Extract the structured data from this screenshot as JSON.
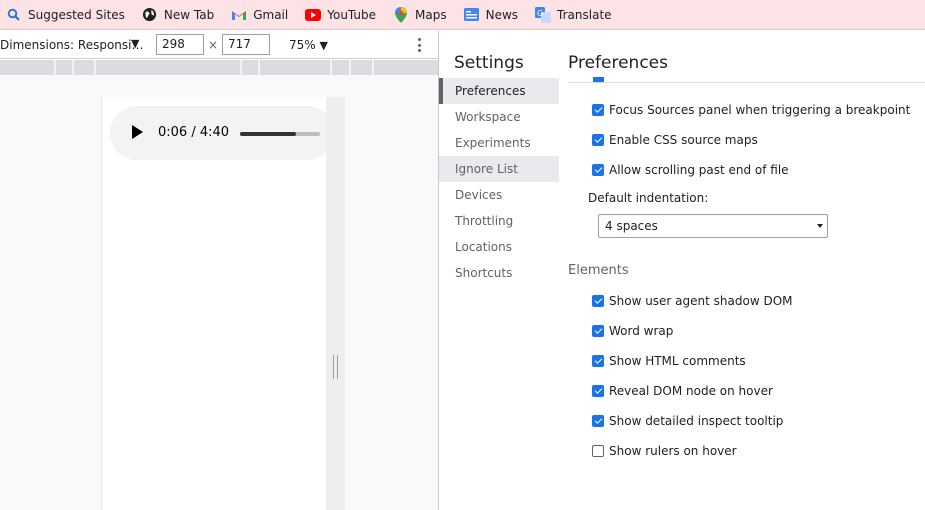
{
  "bookmarks": [
    {
      "label": "Suggested Sites",
      "icon": "search-icon"
    },
    {
      "label": "New Tab",
      "icon": "globe-icon"
    },
    {
      "label": "Gmail",
      "icon": "gmail-icon"
    },
    {
      "label": "YouTube",
      "icon": "youtube-icon"
    },
    {
      "label": "Maps",
      "icon": "maps-pin-icon"
    },
    {
      "label": "News",
      "icon": "news-icon"
    },
    {
      "label": "Translate",
      "icon": "translate-icon"
    }
  ],
  "device_toolbar": {
    "dimensions": "Dimensions: Responsi…",
    "width": "298",
    "height": "717",
    "times": "×",
    "zoom": "75%"
  },
  "audio": {
    "time": "0:06 / 4:40",
    "progress": 0.7
  },
  "settings": {
    "title": "Settings",
    "nav": [
      "Preferences",
      "Workspace",
      "Experiments",
      "Ignore List",
      "Devices",
      "Throttling",
      "Locations",
      "Shortcuts"
    ],
    "selected": "Preferences"
  },
  "preferences": {
    "title": "Preferences",
    "sources_options": [
      {
        "label": "Focus Sources panel when triggering a breakpoint",
        "checked": true
      },
      {
        "label": "Enable CSS source maps",
        "checked": true
      },
      {
        "label": "Allow scrolling past end of file",
        "checked": true
      }
    ],
    "indent_label": "Default indentation:",
    "indent_value": "4 spaces",
    "elements_title": "Elements",
    "elements_options": [
      {
        "label": "Show user agent shadow DOM",
        "checked": true
      },
      {
        "label": "Word wrap",
        "checked": true
      },
      {
        "label": "Show HTML comments",
        "checked": true
      },
      {
        "label": "Reveal DOM node on hover",
        "checked": true
      },
      {
        "label": "Show detailed inspect tooltip",
        "checked": true
      },
      {
        "label": "Show rulers on hover",
        "checked": false
      }
    ]
  },
  "colors": {
    "bookmarks_bg": "#fde2e6",
    "checkbox_accent": "#1a73e8",
    "youtube_red": "#ff0000"
  }
}
